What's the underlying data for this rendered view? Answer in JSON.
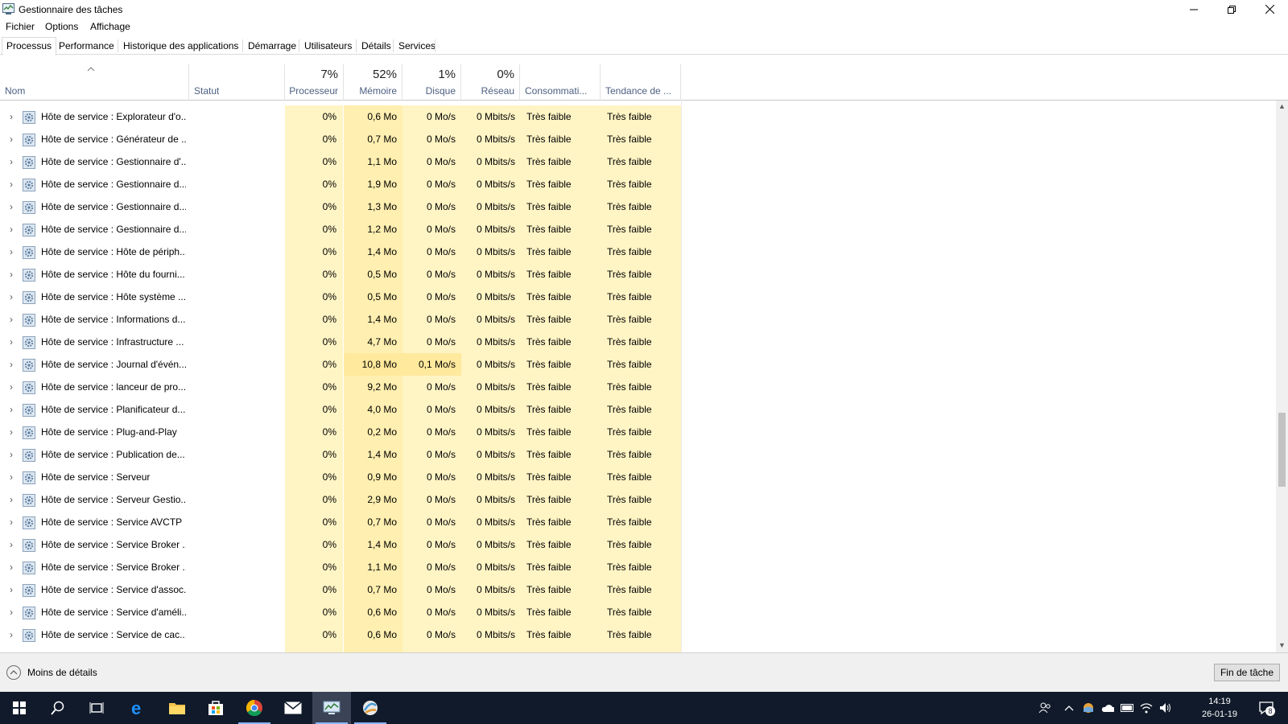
{
  "window": {
    "title": "Gestionnaire des tâches"
  },
  "menu": [
    "Fichier",
    "Options",
    "Affichage"
  ],
  "tabs": [
    {
      "label": "Processus",
      "active": true
    },
    {
      "label": "Performance"
    },
    {
      "label": "Historique des applications"
    },
    {
      "label": "Démarrage"
    },
    {
      "label": "Utilisateurs"
    },
    {
      "label": "Détails"
    },
    {
      "label": "Services"
    }
  ],
  "header": {
    "name": "Nom",
    "status": "Statut",
    "cpu_pct": "7%",
    "cpu": "Processeur",
    "mem_pct": "52%",
    "mem": "Mémoire",
    "disk_pct": "1%",
    "disk": "Disque",
    "net_pct": "0%",
    "net": "Réseau",
    "power": "Consommati...",
    "trend": "Tendance de ..."
  },
  "rows": [
    {
      "name": "Hôte de service : Explorateur d'o...",
      "cpu": "0%",
      "mem": "0,6 Mo",
      "disk": "0 Mo/s",
      "net": "0 Mbits/s",
      "power": "Très faible",
      "trend": "Très faible"
    },
    {
      "name": "Hôte de service : Générateur de ...",
      "cpu": "0%",
      "mem": "0,7 Mo",
      "disk": "0 Mo/s",
      "net": "0 Mbits/s",
      "power": "Très faible",
      "trend": "Très faible"
    },
    {
      "name": "Hôte de service : Gestionnaire d'...",
      "cpu": "0%",
      "mem": "1,1 Mo",
      "disk": "0 Mo/s",
      "net": "0 Mbits/s",
      "power": "Très faible",
      "trend": "Très faible"
    },
    {
      "name": "Hôte de service : Gestionnaire d...",
      "cpu": "0%",
      "mem": "1,9 Mo",
      "disk": "0 Mo/s",
      "net": "0 Mbits/s",
      "power": "Très faible",
      "trend": "Très faible"
    },
    {
      "name": "Hôte de service : Gestionnaire d...",
      "cpu": "0%",
      "mem": "1,3 Mo",
      "disk": "0 Mo/s",
      "net": "0 Mbits/s",
      "power": "Très faible",
      "trend": "Très faible"
    },
    {
      "name": "Hôte de service : Gestionnaire d...",
      "cpu": "0%",
      "mem": "1,2 Mo",
      "disk": "0 Mo/s",
      "net": "0 Mbits/s",
      "power": "Très faible",
      "trend": "Très faible"
    },
    {
      "name": "Hôte de service : Hôte de périph...",
      "cpu": "0%",
      "mem": "1,4 Mo",
      "disk": "0 Mo/s",
      "net": "0 Mbits/s",
      "power": "Très faible",
      "trend": "Très faible"
    },
    {
      "name": "Hôte de service : Hôte du fourni...",
      "cpu": "0%",
      "mem": "0,5 Mo",
      "disk": "0 Mo/s",
      "net": "0 Mbits/s",
      "power": "Très faible",
      "trend": "Très faible"
    },
    {
      "name": "Hôte de service : Hôte système ...",
      "cpu": "0%",
      "mem": "0,5 Mo",
      "disk": "0 Mo/s",
      "net": "0 Mbits/s",
      "power": "Très faible",
      "trend": "Très faible"
    },
    {
      "name": "Hôte de service : Informations d...",
      "cpu": "0%",
      "mem": "1,4 Mo",
      "disk": "0 Mo/s",
      "net": "0 Mbits/s",
      "power": "Très faible",
      "trend": "Très faible"
    },
    {
      "name": "Hôte de service : Infrastructure ...",
      "cpu": "0%",
      "mem": "4,7 Mo",
      "disk": "0 Mo/s",
      "net": "0 Mbits/s",
      "power": "Très faible",
      "trend": "Très faible"
    },
    {
      "name": "Hôte de service : Journal d'évén...",
      "cpu": "0%",
      "mem": "10,8 Mo",
      "disk": "0,1 Mo/s",
      "net": "0 Mbits/s",
      "power": "Très faible",
      "trend": "Très faible",
      "hot": true
    },
    {
      "name": "Hôte de service : lanceur de pro...",
      "cpu": "0%",
      "mem": "9,2 Mo",
      "disk": "0 Mo/s",
      "net": "0 Mbits/s",
      "power": "Très faible",
      "trend": "Très faible"
    },
    {
      "name": "Hôte de service : Planificateur d...",
      "cpu": "0%",
      "mem": "4,0 Mo",
      "disk": "0 Mo/s",
      "net": "0 Mbits/s",
      "power": "Très faible",
      "trend": "Très faible"
    },
    {
      "name": "Hôte de service : Plug-and-Play",
      "cpu": "0%",
      "mem": "0,2 Mo",
      "disk": "0 Mo/s",
      "net": "0 Mbits/s",
      "power": "Très faible",
      "trend": "Très faible"
    },
    {
      "name": "Hôte de service : Publication de...",
      "cpu": "0%",
      "mem": "1,4 Mo",
      "disk": "0 Mo/s",
      "net": "0 Mbits/s",
      "power": "Très faible",
      "trend": "Très faible"
    },
    {
      "name": "Hôte de service : Serveur",
      "cpu": "0%",
      "mem": "0,9 Mo",
      "disk": "0 Mo/s",
      "net": "0 Mbits/s",
      "power": "Très faible",
      "trend": "Très faible"
    },
    {
      "name": "Hôte de service : Serveur Gestio...",
      "cpu": "0%",
      "mem": "2,9 Mo",
      "disk": "0 Mo/s",
      "net": "0 Mbits/s",
      "power": "Très faible",
      "trend": "Très faible"
    },
    {
      "name": "Hôte de service : Service AVCTP",
      "cpu": "0%",
      "mem": "0,7 Mo",
      "disk": "0 Mo/s",
      "net": "0 Mbits/s",
      "power": "Très faible",
      "trend": "Très faible"
    },
    {
      "name": "Hôte de service : Service Broker ...",
      "cpu": "0%",
      "mem": "1,4 Mo",
      "disk": "0 Mo/s",
      "net": "0 Mbits/s",
      "power": "Très faible",
      "trend": "Très faible"
    },
    {
      "name": "Hôte de service : Service Broker ...",
      "cpu": "0%",
      "mem": "1,1 Mo",
      "disk": "0 Mo/s",
      "net": "0 Mbits/s",
      "power": "Très faible",
      "trend": "Très faible"
    },
    {
      "name": "Hôte de service : Service d'assoc...",
      "cpu": "0%",
      "mem": "0,7 Mo",
      "disk": "0 Mo/s",
      "net": "0 Mbits/s",
      "power": "Très faible",
      "trend": "Très faible"
    },
    {
      "name": "Hôte de service : Service d'améli...",
      "cpu": "0%",
      "mem": "0,6 Mo",
      "disk": "0 Mo/s",
      "net": "0 Mbits/s",
      "power": "Très faible",
      "trend": "Très faible"
    },
    {
      "name": "Hôte de service : Service de cac...",
      "cpu": "0%",
      "mem": "0,6 Mo",
      "disk": "0 Mo/s",
      "net": "0 Mbits/s",
      "power": "Très faible",
      "trend": "Très faible"
    }
  ],
  "footer": {
    "less_details": "Moins de détails",
    "end_task": "Fin de tâche"
  },
  "taskbar": {
    "time": "14:19",
    "date": "26-01-19",
    "notification_count": "8",
    "apps": [
      "start-icon",
      "search-icon",
      "task-view-icon",
      "edge-icon",
      "file-explorer-icon",
      "store-icon",
      "chrome-icon",
      "mail-icon",
      "task-manager-icon",
      "app-icon"
    ]
  },
  "colors": {
    "cpu_bg": "#fff4c4",
    "mem_bg": "#ffefb0",
    "hot_bg": "#ffe99c",
    "taskbar": "#101a2a"
  }
}
